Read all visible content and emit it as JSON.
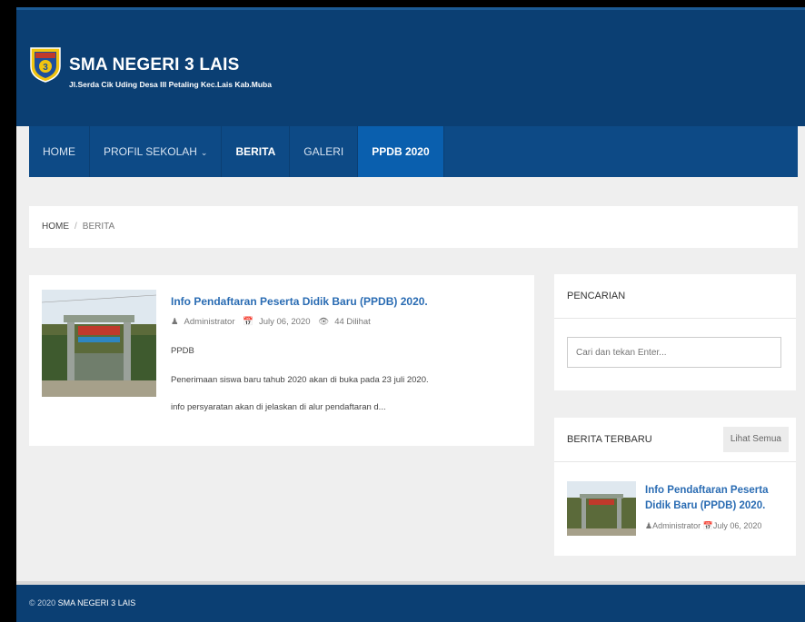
{
  "header": {
    "title": "SMA NEGERI 3 LAIS",
    "subtitle": "Jl.Serda Cik Uding Desa III Petaling Kec.Lais Kab.Muba",
    "logo_icon": "school-crest-icon"
  },
  "nav": {
    "items": [
      {
        "label": "HOME"
      },
      {
        "label": "PROFIL SEKOLAH"
      },
      {
        "label": "BERITA"
      },
      {
        "label": "GALERI"
      },
      {
        "label": "PPDB 2020"
      }
    ],
    "active": "BERITA"
  },
  "breadcrumb": {
    "home": "HOME",
    "separator": "/",
    "current": "BERITA"
  },
  "article": {
    "title": "Info Pendaftaran Peserta Didik Baru (PPDB) 2020.",
    "author": "Administrator",
    "date": "July 06, 2020",
    "views": "44 Dilihat",
    "excerpt_1": "PPDB",
    "excerpt_2": "Penerimaan siswa baru tahub 2020 akan di buka pada 23 juli 2020.",
    "excerpt_3": "info persyaratan akan di jelaskan di alur pendaftaran d..."
  },
  "sidebar": {
    "search_title": "PENCARIAN",
    "search_placeholder": "Cari dan tekan Enter...",
    "recent_title": "BERITA TERBARU",
    "see_all": "Lihat Semua",
    "recent_post": {
      "title": "Info Pendaftaran Peserta Didik Baru (PPDB) 2020.",
      "author": "Administrator",
      "date": "July 06, 2020"
    }
  },
  "footer": {
    "copyright": "© 2020",
    "site": "SMA NEGERI 3 LAIS"
  },
  "colors": {
    "header_bg": "#0b3f73",
    "nav_bg": "#0d4a86",
    "nav_highlight": "#0a5fae",
    "link": "#2a6cb3"
  }
}
